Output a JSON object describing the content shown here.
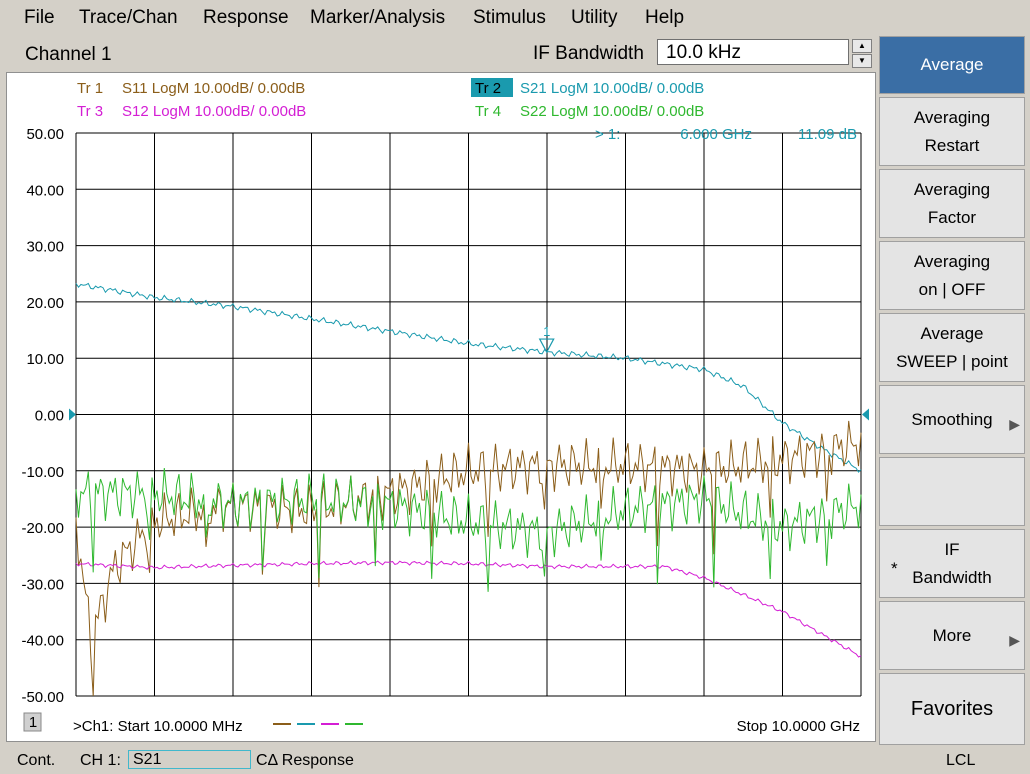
{
  "menu": [
    "File",
    "Trace/Chan",
    "Response",
    "Marker/Analysis",
    "Stimulus",
    "Utility",
    "Help"
  ],
  "channel_title": "Channel 1",
  "ifbw": {
    "label": "IF Bandwidth",
    "value": "10.0 kHz"
  },
  "traces": [
    {
      "id": "Tr  1",
      "label": "S11 LogM 10.00dB/  0.00dB",
      "color": "#8b5e1a"
    },
    {
      "id": "Tr  2",
      "label": "S21 LogM 10.00dB/  0.00dB",
      "color": "#1a9aae"
    },
    {
      "id": "Tr  3",
      "label": "S12 LogM 10.00dB/  0.00dB",
      "color": "#d41ed4"
    },
    {
      "id": "Tr  4",
      "label": "S22 LogM 10.00dB/  0.00dB",
      "color": "#2fb82f"
    }
  ],
  "marker": {
    "prefix": ">  1:",
    "freq": "6.000 GHz",
    "value": "11.09 dB",
    "number": "1"
  },
  "y_ticks": [
    "50.00",
    "40.00",
    "30.00",
    "20.00",
    "10.00",
    "0.00",
    "-10.00",
    "-20.00",
    "-30.00",
    "-40.00",
    "-50.00"
  ],
  "footer": {
    "channel_num": "1",
    "start": ">Ch1: Start  10.0000 MHz",
    "stop": "Stop  10.0000 GHz"
  },
  "softkeys": [
    {
      "lines": [
        "Average"
      ],
      "active": true
    },
    {
      "lines": [
        "Averaging",
        "Restart"
      ]
    },
    {
      "lines": [
        "Averaging",
        "Factor"
      ]
    },
    {
      "lines": [
        "Averaging",
        "on | OFF"
      ]
    },
    {
      "lines": [
        "Average",
        "SWEEP | point"
      ]
    },
    {
      "lines": [
        "Smoothing"
      ],
      "arrow": true
    },
    {
      "lines": [
        ""
      ]
    },
    {
      "lines": [
        "IF",
        "Bandwidth"
      ],
      "star": "*"
    },
    {
      "lines": [
        "More"
      ],
      "arrow": true
    },
    {
      "lines": [
        "Favorites"
      ]
    }
  ],
  "status": {
    "mode": "Cont.",
    "ch": "CH 1:",
    "trace": "S21",
    "response": "CΔ Response",
    "lcl": "LCL"
  },
  "chart_data": {
    "type": "line",
    "x_range": [
      0.01,
      10.0
    ],
    "x_unit": "GHz",
    "ylim": [
      -50,
      50
    ],
    "series": [
      {
        "name": "S21",
        "points": [
          [
            0.01,
            23.2
          ],
          [
            1.0,
            20.8
          ],
          [
            2.0,
            19.2
          ],
          [
            3.0,
            17.0
          ],
          [
            4.0,
            14.8
          ],
          [
            5.0,
            12.6
          ],
          [
            6.0,
            11.09
          ],
          [
            7.0,
            10.0
          ],
          [
            8.0,
            8.0
          ],
          [
            8.5,
            5.0
          ],
          [
            9.0,
            -1.5
          ],
          [
            9.5,
            -6.0
          ],
          [
            10.0,
            -10.0
          ]
        ]
      },
      {
        "name": "S11",
        "points": [
          [
            0.01,
            -19
          ],
          [
            0.2,
            -40
          ],
          [
            0.5,
            -27
          ],
          [
            1.0,
            -19
          ],
          [
            2.0,
            -16
          ],
          [
            3.0,
            -17
          ],
          [
            4.0,
            -14
          ],
          [
            5.0,
            -10
          ],
          [
            6.0,
            -9
          ],
          [
            7.0,
            -9
          ],
          [
            8.0,
            -10
          ],
          [
            9.0,
            -8
          ],
          [
            10.0,
            -5
          ]
        ]
      },
      {
        "name": "S12",
        "points": [
          [
            0.01,
            -26.5
          ],
          [
            1.0,
            -27.2
          ],
          [
            2.0,
            -26.8
          ],
          [
            3.0,
            -26.5
          ],
          [
            4.0,
            -26.3
          ],
          [
            5.0,
            -26.5
          ],
          [
            6.0,
            -27.0
          ],
          [
            7.0,
            -27.0
          ],
          [
            7.5,
            -27.0
          ],
          [
            8.0,
            -29.0
          ],
          [
            9.0,
            -35.0
          ],
          [
            10.0,
            -43.0
          ]
        ]
      },
      {
        "name": "S22",
        "points": [
          [
            0.01,
            -14
          ],
          [
            1.0,
            -14
          ],
          [
            2.0,
            -16
          ],
          [
            3.0,
            -15
          ],
          [
            4.0,
            -16
          ],
          [
            5.0,
            -19
          ],
          [
            6.0,
            -21
          ],
          [
            7.0,
            -17
          ],
          [
            8.0,
            -15
          ],
          [
            9.0,
            -20
          ],
          [
            10.0,
            -16
          ]
        ]
      }
    ]
  }
}
